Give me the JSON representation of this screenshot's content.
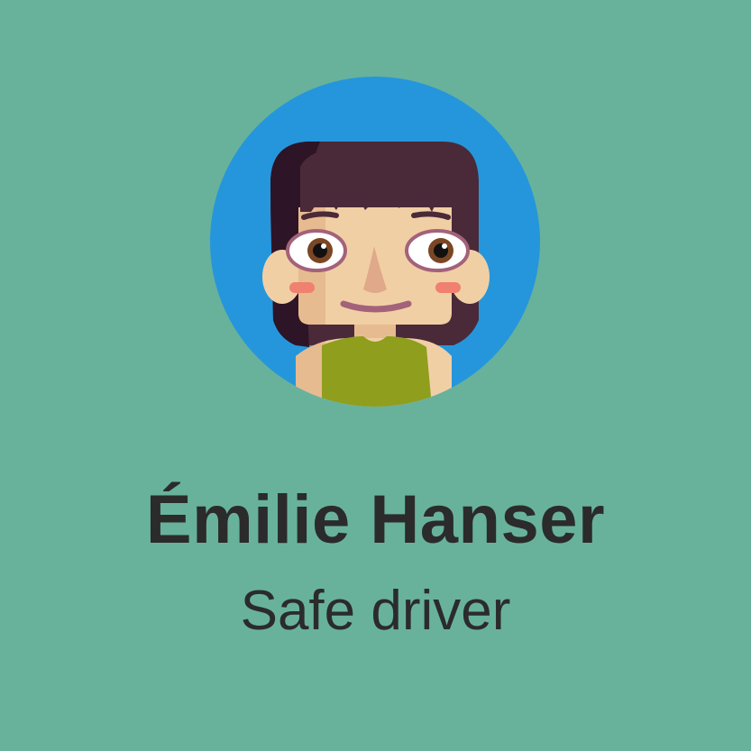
{
  "profile": {
    "name": "Émilie Hanser",
    "subtitle": "Safe driver",
    "avatar_icon": "girl-avatar-icon"
  },
  "colors": {
    "background": "#68b29b",
    "avatar_circle": "#2596dc",
    "text": "#2b2b2b",
    "hair": "#4a2a38",
    "skin": "#f1cfa5",
    "shirt": "#8f9e1c"
  }
}
